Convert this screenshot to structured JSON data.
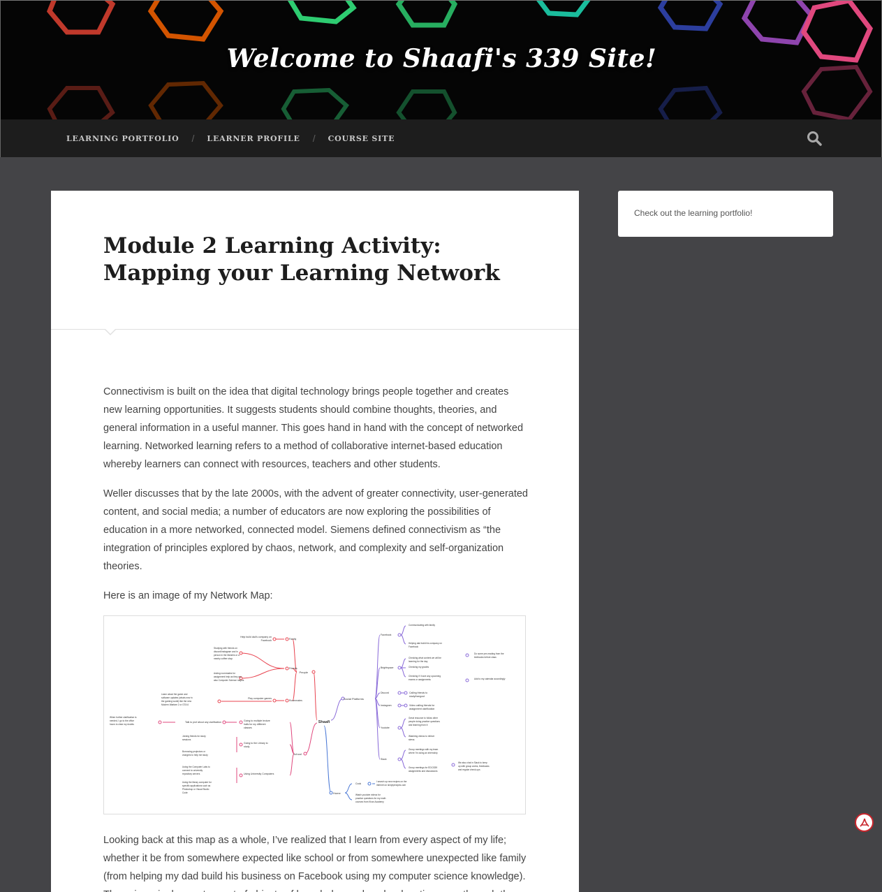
{
  "site": {
    "title": "Welcome to Shaafi's 339 Site!"
  },
  "nav": {
    "items": [
      "LEARNING PORTFOLIO",
      "LEARNER PROFILE",
      "COURSE SITE"
    ],
    "separator": "/",
    "search_icon": "search-icon"
  },
  "post": {
    "title": "Module 2 Learning Activity: Mapping your Learning Network",
    "paragraphs": [
      "Connectivism is built on the idea that digital technology brings people together and creates new learning opportunities. It suggests students should combine thoughts, theories, and general information in a useful manner. This goes hand in hand with the concept of networked learning. Networked learning refers to a method of collaborative internet-based education whereby learners can connect with resources, teachers and other students.",
      "Weller discusses that by the late 2000s, with the advent of greater connectivity, user-generated content, and social media; a number of educators are now exploring the possibilities of education in a more networked, connected model. Siemens defined connectivism as “the integration of principles explored by chaos, network, and complexity and self-organization theories.",
      "Here is an image of my Network Map:"
    ],
    "after_map": "Looking back at this map as a whole, I’ve realized that I learn from every aspect of my life; whether it be from somewhere expected like school or from somewhere unexpected like family (from helping my dad build his business on Facebook using my computer science knowledge). These is a single way to a set of objects of knowledge and each education pass through the"
  },
  "network_map": {
    "center": "Shaafi",
    "left": {
      "people": {
        "label": "People",
        "children": [
          {
            "label": "Family",
            "leaf": "Help build dad's company on Facebook"
          },
          {
            "label": "Friends",
            "leaves": [
              "Studying with friends on discord/instagram and in person in the libraries or a nearby coffee shop",
              "Asking roommates for assignment help as they are also Computer Science majors"
            ]
          },
          {
            "label": "Roommates",
            "leaf": "Play computer games",
            "subleaf": "Learn about the game and software updates (whats new in the gaming world) like the new Modern Warfare 2 or GTA 6"
          }
        ]
      },
      "school": {
        "label": "School",
        "children": [
          {
            "label": "Going to multiple lecture halls for my different classes",
            "leaf": "Talk to prof about any clarification",
            "subleaf": "When further clarification is needed, I go to the office hours to clear my doubts"
          },
          {
            "label": "Going to the Library to study",
            "leaves": [
              "Joining friends for study sessions",
              "Borrowing projectors or chargers to help me study"
            ]
          },
          {
            "label": "Using University Computers",
            "leaves": [
              "Using the Computer Labs to connect to university repository servers",
              "Using the library computer for specific applications such as Photoshop or Visual Studio Code"
            ]
          }
        ]
      }
    },
    "right": {
      "social": {
        "label": "Social Platforms",
        "children": [
          {
            "label": "Facebook",
            "leaves": [
              "Communicating with family",
              "Helping dad build his company on Facebook"
            ]
          },
          {
            "label": "Brightspace",
            "leaves": [
              "Checking what content we will be learning for the day",
              "Checking my grades",
              "Checking if I have any upcoming exams or assignments"
            ],
            "extras": [
              "Do some pre-reading from the textbooks before class",
              "Add to my calendar accordingly"
            ]
          },
          {
            "label": "Discord",
            "leaf": "Calling friends to study/hangout"
          },
          {
            "label": "Instagram",
            "leaf": "Video calling friends for assignment clarification"
          },
          {
            "label": "Youtube",
            "leaves": [
              "Great resource to follow other people doing practice questions and learning from it",
              "Watching videos to relieve stress"
            ]
          },
          {
            "label": "Slack",
            "leaves": [
              "Group meetings with my team where I'm doing an internship",
              "Group meetings for EDCI339 assignments and discussions"
            ],
            "extra": "We also chat in Slack to keep up with group works, feedbacks and regular check-ups"
          }
        ]
      },
      "home": {
        "label": "Home",
        "children": [
          {
            "label": "Cook",
            "leaf": "I search up new recipes on the internet on simplyrecipes.com"
          },
          {
            "label": "Watch youtube videos for practice questions for my math courses from Khan Academy"
          }
        ]
      }
    },
    "colors": {
      "red": "#e8434f",
      "purple": "#8a6bd9",
      "blue": "#4a78d6",
      "pink": "#e0487e"
    }
  },
  "sidebar": {
    "widget_text": "Check out the learning portfolio!"
  },
  "pdf_badge": {
    "icon": "pdf-icon",
    "color": "#c9252c"
  }
}
